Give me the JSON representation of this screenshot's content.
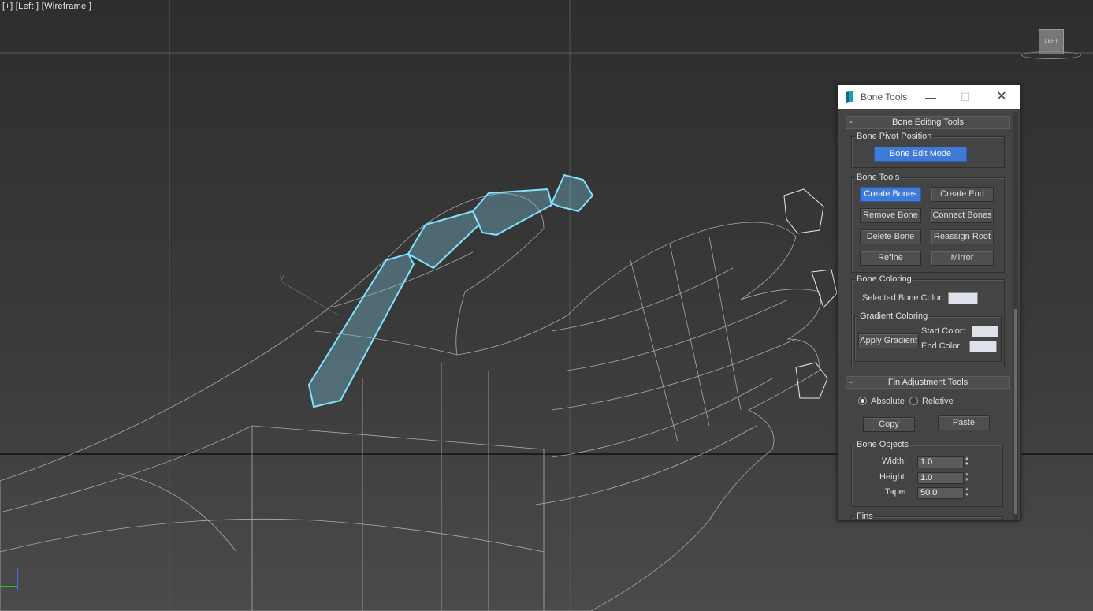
{
  "viewport": {
    "label": "[+] [Left ] [Wireframe ]",
    "viewcube_label": "LEFT",
    "axis_label": "y"
  },
  "dialog": {
    "title": "Bone Tools",
    "bone_editing": {
      "header": "Bone Editing Tools",
      "toggle": "-",
      "pivot_group": "Bone Pivot Position",
      "edit_mode": "Bone Edit Mode",
      "tools_group": "Bone Tools",
      "buttons": {
        "create_bones": "Create Bones",
        "create_end": "Create End",
        "remove_bone": "Remove Bone",
        "connect_bones": "Connect Bones",
        "delete_bone": "Delete Bone",
        "reassign_root": "Reassign Root",
        "refine": "Refine",
        "mirror": "Mirror"
      },
      "coloring_group": "Bone Coloring",
      "selected_color_label": "Selected Bone Color:",
      "gradient_group": "Gradient Coloring",
      "apply_gradient": "Apply Gradient",
      "start_color_label": "Start Color:",
      "end_color_label": "End Color:"
    },
    "fin_adjustment": {
      "header": "Fin Adjustment Tools",
      "toggle": "-",
      "absolute": "Absolute",
      "relative": "Relative",
      "copy": "Copy",
      "paste": "Paste",
      "objects_group": "Bone Objects",
      "width_label": "Width:",
      "width_value": "1.0",
      "height_label": "Height:",
      "height_value": "1.0",
      "taper_label": "Taper:",
      "taper_value": "50.0",
      "fins_group": "Fins"
    }
  }
}
